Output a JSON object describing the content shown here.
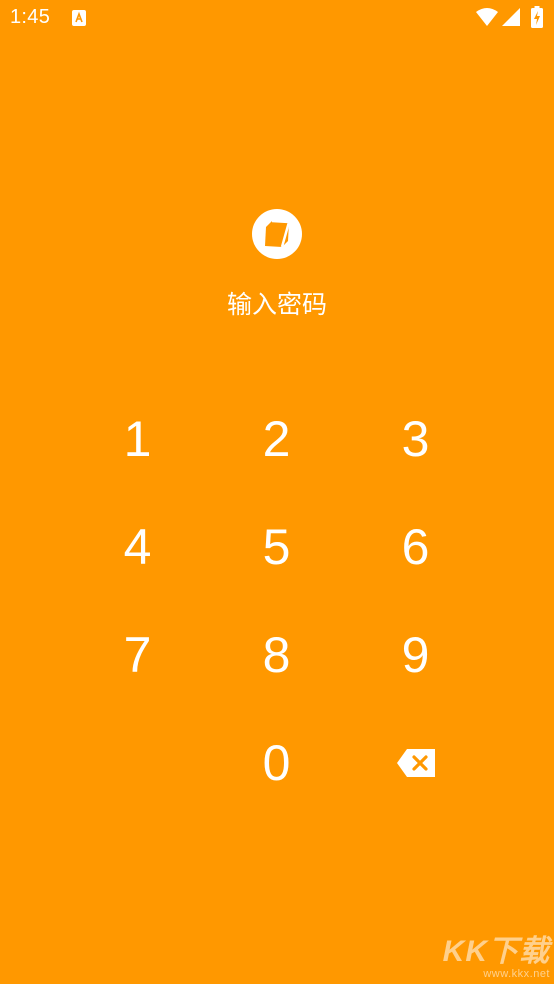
{
  "status_bar": {
    "time": "1:45",
    "icons": [
      "notification-a-icon",
      "wifi-icon",
      "signal-icon",
      "battery-charging-icon"
    ]
  },
  "lock_screen": {
    "logo_icon": "app-logo-icon",
    "prompt": "输入密码"
  },
  "keypad": {
    "keys": [
      "1",
      "2",
      "3",
      "4",
      "5",
      "6",
      "7",
      "8",
      "9",
      "",
      "0",
      "backspace-icon"
    ]
  },
  "watermark": {
    "brand": "KK下载",
    "url": "www.kkx.net"
  },
  "colors": {
    "background": "#FF9800",
    "foreground": "#FFFFFF"
  }
}
